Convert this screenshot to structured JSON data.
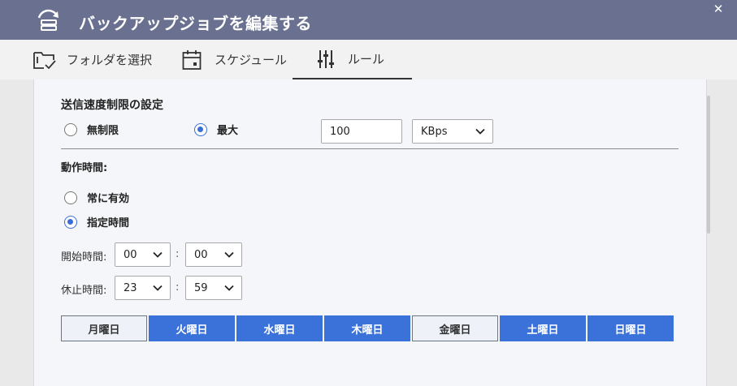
{
  "dialog": {
    "title": "バックアップジョブを編集する",
    "close_icon": "✕"
  },
  "tabs": [
    {
      "label": "フォルダを選択",
      "icon": "folder-check-icon"
    },
    {
      "label": "スケジュール",
      "icon": "calendar-icon"
    },
    {
      "label": "ルール",
      "icon": "sliders-icon",
      "active": true
    }
  ],
  "bandwidth": {
    "title": "送信速度制限の設定",
    "unlimited_label": "無制限",
    "max_label": "最大",
    "selected": "max",
    "value": "100",
    "unit": "KBps"
  },
  "schedule": {
    "title": "動作時間:",
    "always_label": "常に有効",
    "specified_label": "指定時間",
    "selected": "specified",
    "start_label": "開始時間:",
    "start_hour": "00",
    "start_minute": "00",
    "stop_label": "休止時間:",
    "stop_hour": "23",
    "stop_minute": "59",
    "separator": ":"
  },
  "days": [
    {
      "label": "月曜日",
      "selected": false
    },
    {
      "label": "火曜日",
      "selected": true
    },
    {
      "label": "水曜日",
      "selected": true
    },
    {
      "label": "木曜日",
      "selected": true
    },
    {
      "label": "金曜日",
      "selected": false
    },
    {
      "label": "土曜日",
      "selected": true
    },
    {
      "label": "日曜日",
      "selected": true
    }
  ],
  "colors": {
    "header": "#6a7190",
    "accent": "#3b72d9"
  }
}
